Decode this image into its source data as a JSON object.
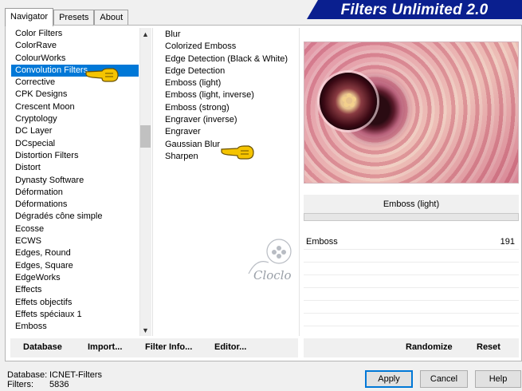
{
  "tabs": [
    {
      "label": "Navigator"
    },
    {
      "label": "Presets"
    },
    {
      "label": "About"
    }
  ],
  "app_title": "Filters Unlimited 2.0",
  "categories": [
    "Color Filters",
    "ColorRave",
    "ColourWorks",
    "Convolution Filters",
    "Corrective",
    "CPK Designs",
    "Crescent Moon",
    "Cryptology",
    "DC Layer",
    "DCspecial",
    "Distortion Filters",
    "Distort",
    "Dynasty Software",
    "Déformation",
    "Déformations",
    "Dégradés cône simple",
    "Ecosse",
    "ECWS",
    "Edges, Round",
    "Edges, Square",
    "EdgeWorks",
    "Effects",
    "Effets objectifs",
    "Effets spéciaux 1",
    "Emboss"
  ],
  "selected_category": "Convolution Filters",
  "filters": [
    "Blur",
    "Colorized Emboss",
    "Edge Detection (Black & White)",
    "Edge Detection",
    "Emboss (light)",
    "Emboss (light, inverse)",
    "Emboss (strong)",
    "Engraver (inverse)",
    "Engraver",
    "Gaussian Blur",
    "Sharpen"
  ],
  "selected_filter": "Emboss (light)",
  "parameter": {
    "label": "Emboss",
    "value": "191"
  },
  "left_buttons": {
    "database": "Database",
    "import": "Import...",
    "filter_info": "Filter Info...",
    "editor": "Editor..."
  },
  "right_buttons": {
    "randomize": "Randomize",
    "reset": "Reset"
  },
  "status": {
    "database_label": "Database:",
    "database_value": "ICNET-Filters",
    "filters_label": "Filters:",
    "filters_value": "5836"
  },
  "dialog_buttons": {
    "apply": "Apply",
    "cancel": "Cancel",
    "help": "Help"
  },
  "watermark": {
    "signature": "Cloclo"
  },
  "icons": {
    "pointer": "pointing-hand-icon",
    "scroll_up": "chevron-up-icon",
    "scroll_down": "chevron-down-icon"
  },
  "colors": {
    "banner": "#0a1f8f",
    "selection": "#0078d7",
    "hand": "#f5c400"
  }
}
